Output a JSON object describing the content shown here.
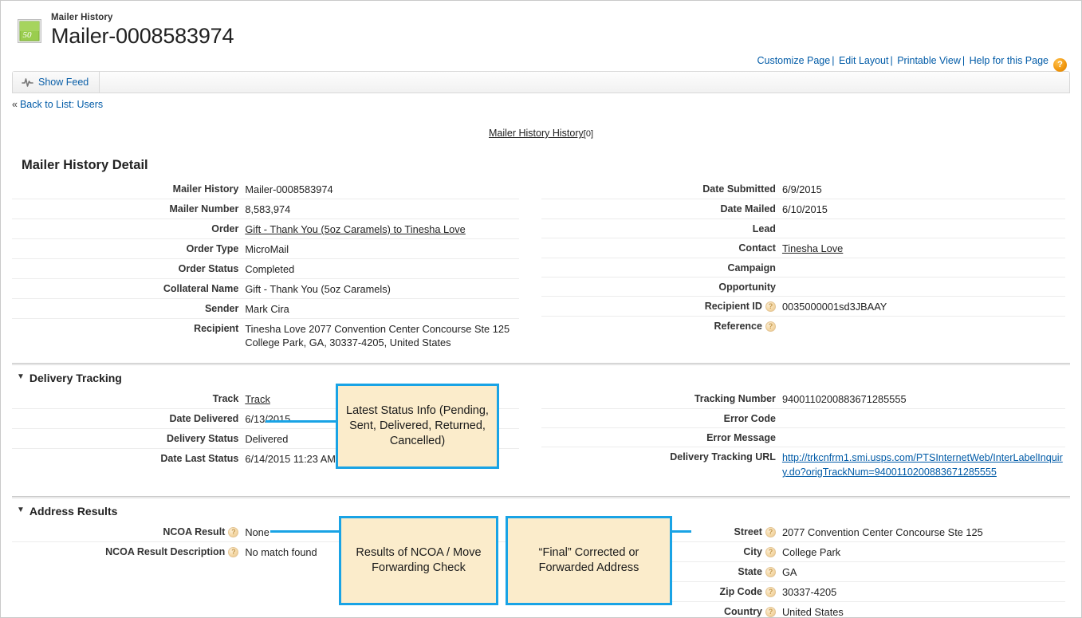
{
  "header": {
    "object_type": "Mailer History",
    "record_title": "Mailer-0008583974",
    "icon": "postage-stamp-icon",
    "stamp_value": "50",
    "links": [
      {
        "label": "Customize Page"
      },
      {
        "label": "Edit Layout"
      },
      {
        "label": "Printable View"
      },
      {
        "label": "Help for this Page"
      }
    ],
    "help_icon": "question-mark-icon",
    "separator": "|"
  },
  "feed": {
    "show_feed_label": "Show Feed",
    "feed_icon": "feed-waveform-icon"
  },
  "back": {
    "chevron": "«",
    "label": "Back to List: Users"
  },
  "toplinks": {
    "related_list_label": "Mailer History History",
    "count": "[0]"
  },
  "detail": {
    "block_title": "Mailer History Detail",
    "left_fields": [
      {
        "label": "Mailer History",
        "value": "Mailer-0008583974",
        "type": "text"
      },
      {
        "label": "Mailer Number",
        "value": "8,583,974",
        "type": "text"
      },
      {
        "label": "Order",
        "value": "Gift - Thank You (5oz Caramels) to Tinesha Love",
        "type": "link"
      },
      {
        "label": "Order Type",
        "value": "MicroMail",
        "type": "text"
      },
      {
        "label": "Order Status",
        "value": "Completed",
        "type": "text"
      },
      {
        "label": "Collateral Name",
        "value": "Gift - Thank You (5oz Caramels)",
        "type": "text"
      },
      {
        "label": "Sender",
        "value": "Mark Cira",
        "type": "text"
      },
      {
        "label": "Recipient",
        "value": "Tinesha Love 2077 Convention Center Concourse Ste 125\nCollege Park, GA, 30337-4205, United States",
        "type": "multiline"
      }
    ],
    "right_fields": [
      {
        "label": "Date Submitted",
        "value": "6/9/2015",
        "type": "text"
      },
      {
        "label": "Date Mailed",
        "value": "6/10/2015",
        "type": "text"
      },
      {
        "label": "Lead",
        "value": "",
        "type": "text"
      },
      {
        "label": "Contact",
        "value": "Tinesha Love",
        "type": "link"
      },
      {
        "label": "Campaign",
        "value": "",
        "type": "text"
      },
      {
        "label": "Opportunity",
        "value": "",
        "type": "text"
      },
      {
        "label": "Recipient ID",
        "value": "0035000001sd3JBAAY",
        "type": "text",
        "help": true
      },
      {
        "label": "Reference",
        "value": "",
        "type": "text",
        "help": true
      }
    ]
  },
  "delivery": {
    "section_title": "Delivery Tracking",
    "left_fields": [
      {
        "label": "Track",
        "value": "Track",
        "type": "link"
      },
      {
        "label": "Date Delivered",
        "value": "6/13/2015",
        "type": "text"
      },
      {
        "label": "Delivery Status",
        "value": "Delivered",
        "type": "text"
      },
      {
        "label": "Date Last Status",
        "value": "6/14/2015 11:23 AM",
        "type": "text"
      }
    ],
    "right_fields": [
      {
        "label": "Tracking Number",
        "value": "9400110200883671285555",
        "type": "text"
      },
      {
        "label": "Error Code",
        "value": "",
        "type": "text"
      },
      {
        "label": "Error Message",
        "value": "",
        "type": "text"
      },
      {
        "label": "Delivery Tracking URL",
        "value": "http://trkcnfrm1.smi.usps.com/PTSInternetWeb/InterLabelInquiry.do?origTrackNum=9400110200883671285555",
        "type": "url"
      }
    ]
  },
  "address": {
    "section_title": "Address Results",
    "left_fields": [
      {
        "label": "NCOA Result",
        "value": "None",
        "type": "text",
        "help": true
      },
      {
        "label": "NCOA Result Description",
        "value": "No match found",
        "type": "text",
        "help": true
      }
    ],
    "right_fields": [
      {
        "label": "Street",
        "value": "2077 Convention Center Concourse Ste 125",
        "type": "text",
        "help": true
      },
      {
        "label": "City",
        "value": "College Park",
        "type": "text",
        "help": true
      },
      {
        "label": "State",
        "value": "GA",
        "type": "text",
        "help": true
      },
      {
        "label": "Zip Code",
        "value": "30337-4205",
        "type": "text",
        "help": true
      },
      {
        "label": "Country",
        "value": "United States",
        "type": "text",
        "help": true
      }
    ]
  },
  "callouts": [
    {
      "id": "status-callout",
      "text": "Latest Status Info (Pending, Sent, Delivered, Returned, Cancelled)"
    },
    {
      "id": "ncoa-callout",
      "text": "Results of NCOA / Move Forwarding Check"
    },
    {
      "id": "final-address-callout",
      "text": "“Final” Corrected or Forwarded Address"
    }
  ],
  "colors": {
    "callout_fill": "#fbeccb",
    "callout_border": "#19a3e5",
    "link_blue": "#015ba7",
    "stamp_green": "#8dc63f",
    "help_orange": "#f0950b"
  }
}
